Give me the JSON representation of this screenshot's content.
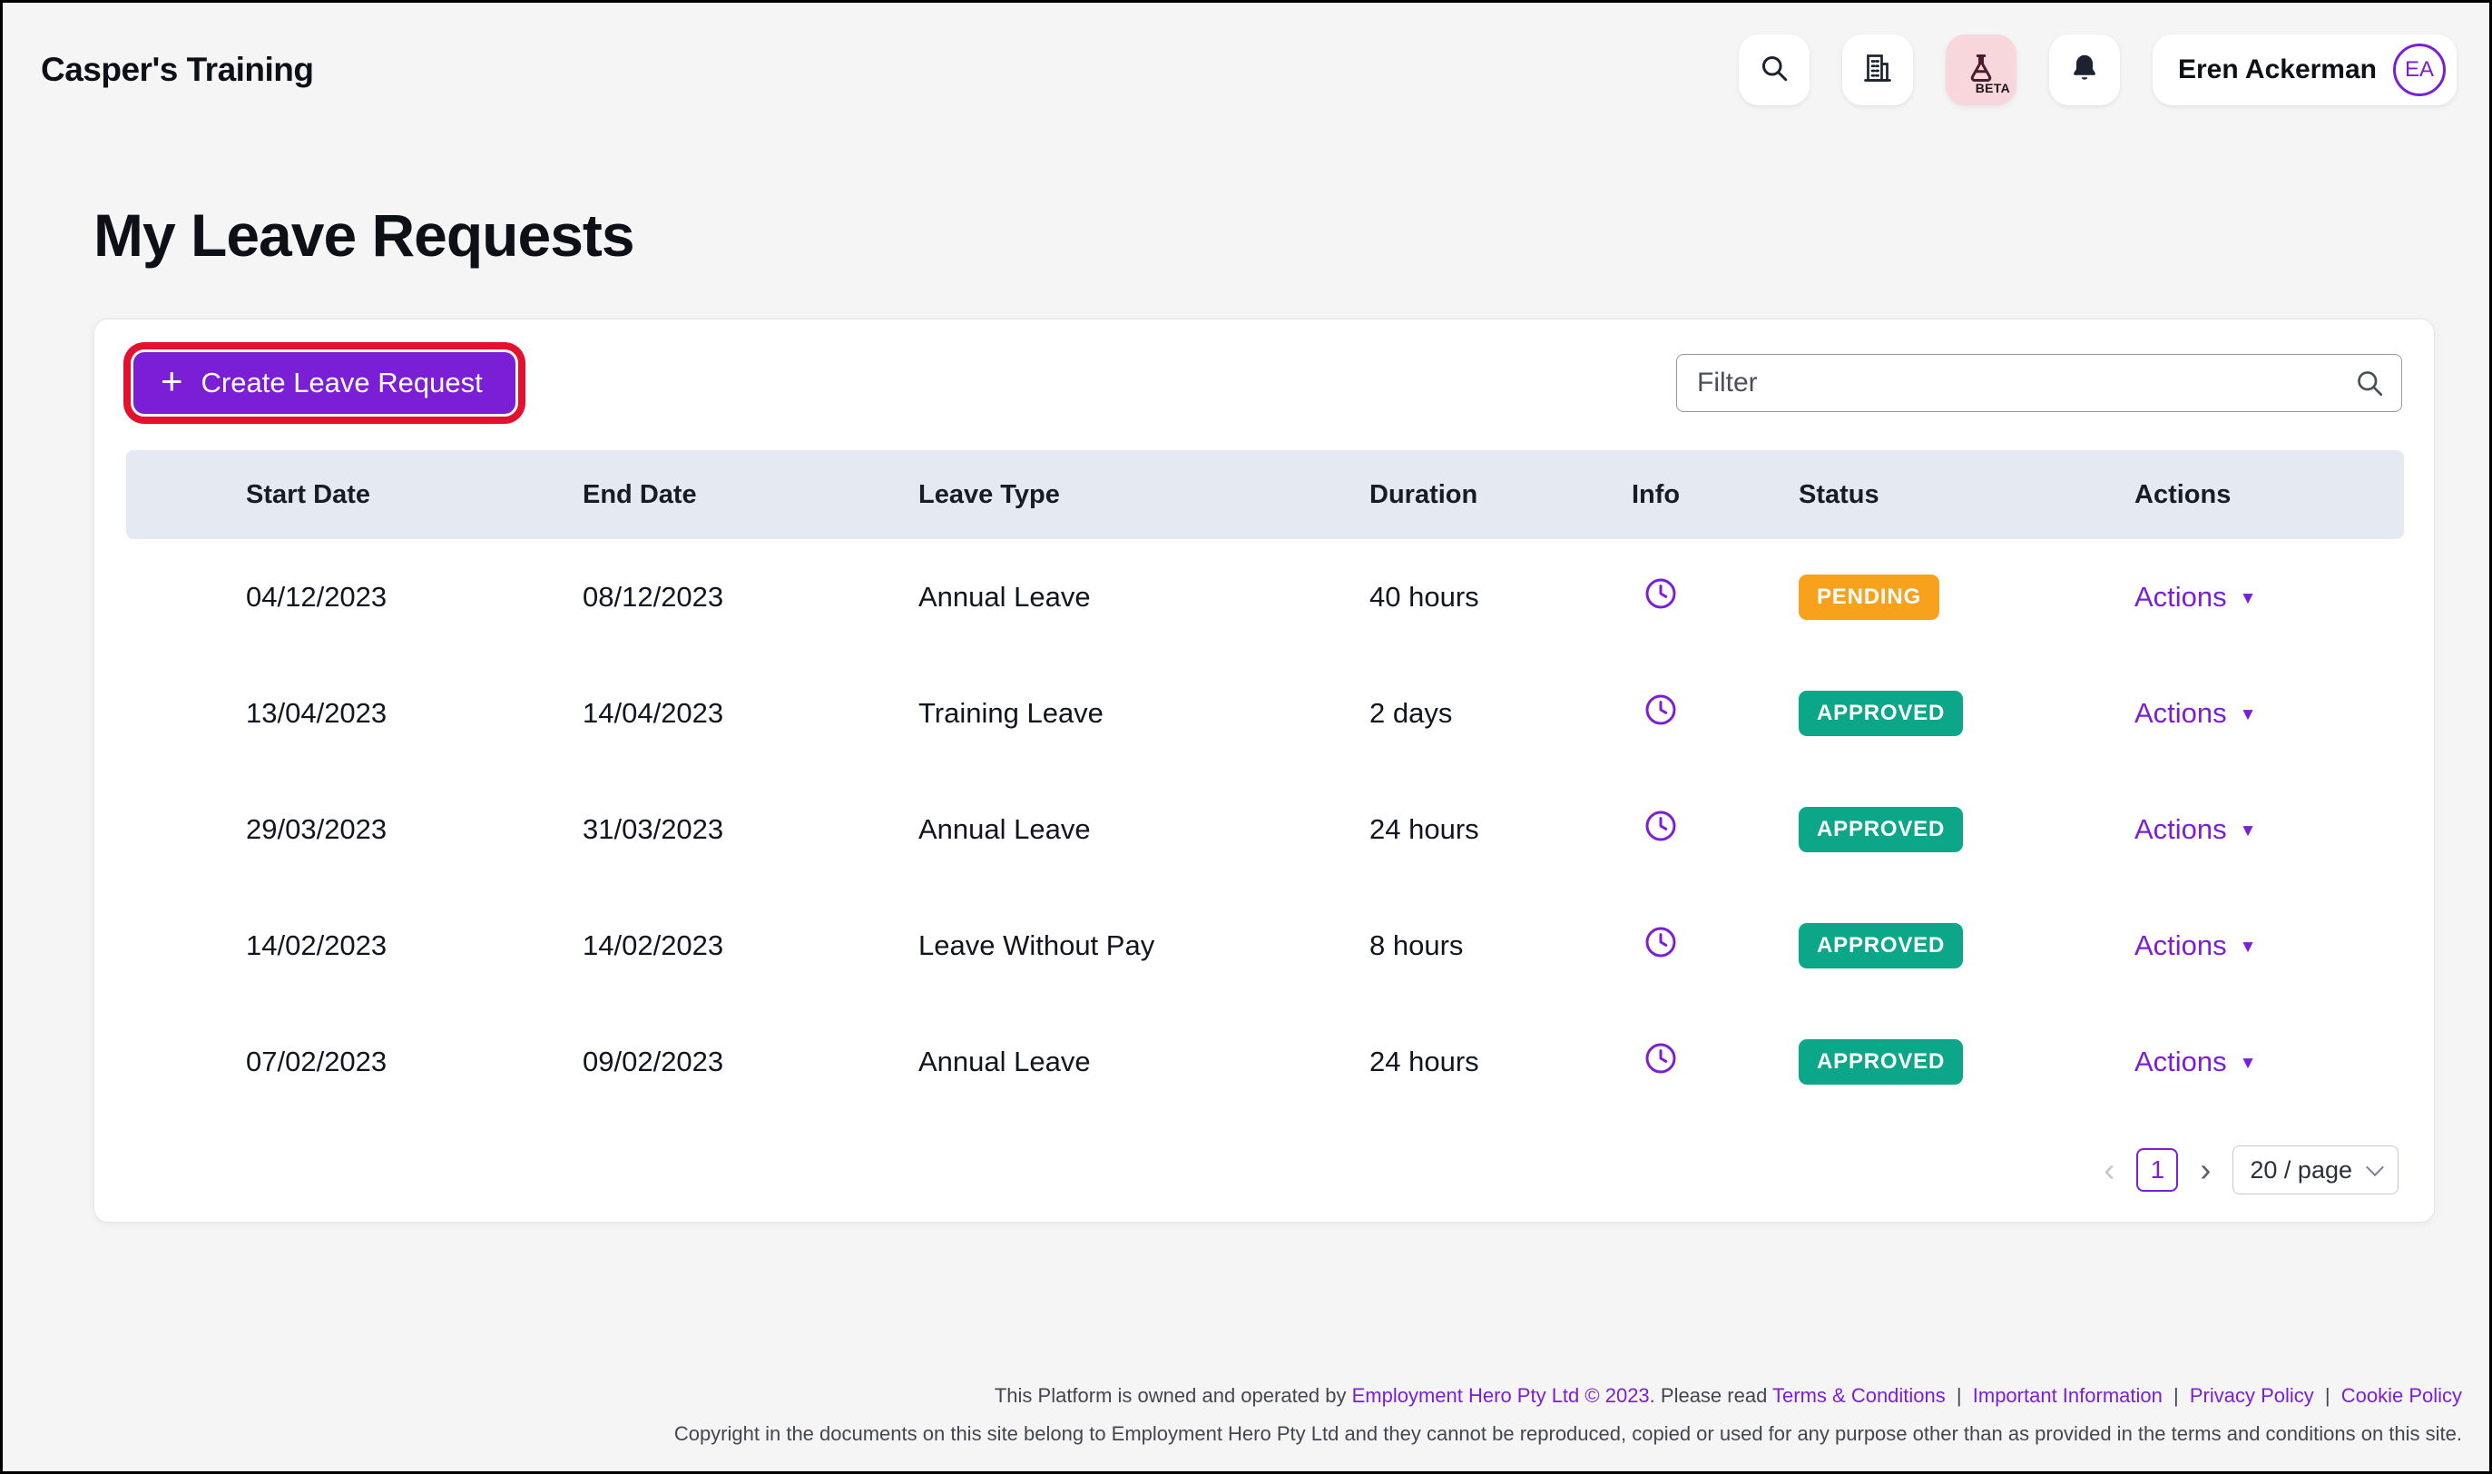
{
  "colors": {
    "accent": "#7B1FD6",
    "highlight_ring": "#E4112E",
    "table_header_bg": "#E4E9F2",
    "page_bg": "#F5F5F6",
    "pending": "#F7A11C",
    "approved": "#0CA789"
  },
  "header": {
    "brand": "Casper's Training",
    "beta_badge": "BETA",
    "user": {
      "name": "Eren Ackerman",
      "initials": "EA"
    },
    "icons": [
      "search-icon",
      "organisation-icon",
      "beta-flask-icon",
      "bell-icon"
    ]
  },
  "page": {
    "title": "My Leave Requests"
  },
  "toolbar": {
    "create_label": "Create Leave Request",
    "filter_placeholder": "Filter"
  },
  "table": {
    "columns": [
      "Start Date",
      "End Date",
      "Leave Type",
      "Duration",
      "Info",
      "Status",
      "Actions"
    ],
    "actions_label": "Actions",
    "info_icon": "clock-icon",
    "status_colors": {
      "PENDING": "#F7A11C",
      "APPROVED": "#0CA789"
    },
    "rows": [
      {
        "start_date": "04/12/2023",
        "end_date": "08/12/2023",
        "leave_type": "Annual Leave",
        "duration": "40 hours",
        "status": "PENDING"
      },
      {
        "start_date": "13/04/2023",
        "end_date": "14/04/2023",
        "leave_type": "Training Leave",
        "duration": "2 days",
        "status": "APPROVED"
      },
      {
        "start_date": "29/03/2023",
        "end_date": "31/03/2023",
        "leave_type": "Annual Leave",
        "duration": "24 hours",
        "status": "APPROVED"
      },
      {
        "start_date": "14/02/2023",
        "end_date": "14/02/2023",
        "leave_type": "Leave Without Pay",
        "duration": "8 hours",
        "status": "APPROVED"
      },
      {
        "start_date": "07/02/2023",
        "end_date": "09/02/2023",
        "leave_type": "Annual Leave",
        "duration": "24 hours",
        "status": "APPROVED"
      }
    ]
  },
  "pagination": {
    "current_page": "1",
    "page_size": "20 / page"
  },
  "footer": {
    "line1_text": "This Platform is owned and operated by",
    "company_link": "Employment Hero Pty Ltd © 2023",
    "line1_after": ". Please read",
    "links": [
      "Terms & Conditions",
      "Important Information",
      "Privacy Policy",
      "Cookie Policy"
    ],
    "separator": "|",
    "line2": "Copyright in the documents on this site belong to Employment Hero Pty Ltd and they cannot be reproduced, copied or used for any purpose other than as provided in the terms and conditions on this site."
  }
}
